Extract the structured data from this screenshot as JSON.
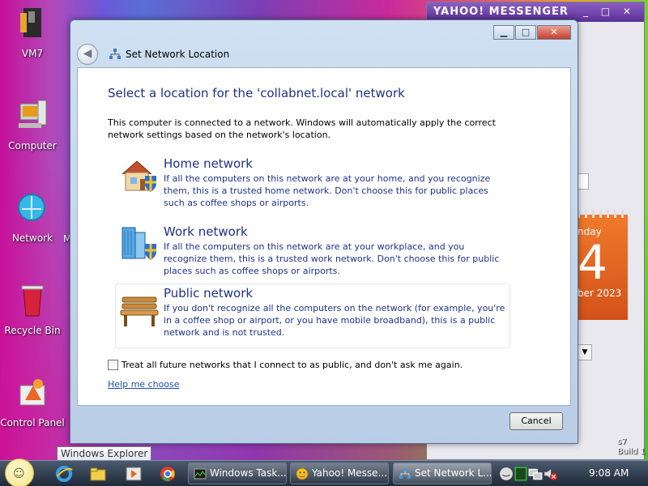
{
  "desktop": {
    "icons": [
      {
        "label": "VM7",
        "icon": "vm-icon"
      },
      {
        "label": "Computer",
        "icon": "computer-icon"
      },
      {
        "label": "Network",
        "icon": "network-icon"
      },
      {
        "label": "Recycle Bin",
        "icon": "recycle-bin-icon"
      },
      {
        "label": "Control Panel",
        "icon": "control-panel-icon"
      }
    ],
    "partial_label": "M"
  },
  "yahoo_window": {
    "title": "YAHOO! MESSENGER",
    "calendar": {
      "day_fragment": "nday",
      "date_fragment": "4",
      "month_fragment": "ber 2023"
    },
    "fragment_bottom": "s7\nBuild 1"
  },
  "dialog": {
    "title": "Set Network Location",
    "heading": "Select a location for the 'collabnet.local' network",
    "intro": "This computer is connected to a network. Windows will automatically apply the correct network settings based on the network's location.",
    "options": [
      {
        "title": "Home network",
        "description": "If all the computers on this network are at your home, and you recognize them, this is a trusted home network.  Don't choose this for public places such as coffee shops or airports.",
        "icon": "home-network-icon"
      },
      {
        "title": "Work network",
        "description": "If all the computers on this network are at your workplace, and you recognize them, this is a trusted work network.  Don't choose this for public places such as coffee shops or airports.",
        "icon": "work-network-icon"
      },
      {
        "title": "Public network",
        "description": "If you don't recognize all the computers on the network (for example, you're in a coffee shop or airport, or you have mobile broadband), this is a public network and is not trusted.",
        "icon": "public-network-icon"
      }
    ],
    "checkbox_label": "Treat all future networks that I connect to as public, and don't ask me again.",
    "help_link": "Help me choose",
    "cancel_label": "Cancel"
  },
  "taskbar": {
    "tooltip": "Windows Explorer",
    "tasks": [
      {
        "label": "Windows Task...",
        "icon": "task-manager-icon"
      },
      {
        "label": "Yahoo! Messe...",
        "icon": "yahoo-messenger-icon"
      },
      {
        "label": "Set Network L...",
        "icon": "network-icon"
      }
    ],
    "clock": "9:08 AM"
  }
}
